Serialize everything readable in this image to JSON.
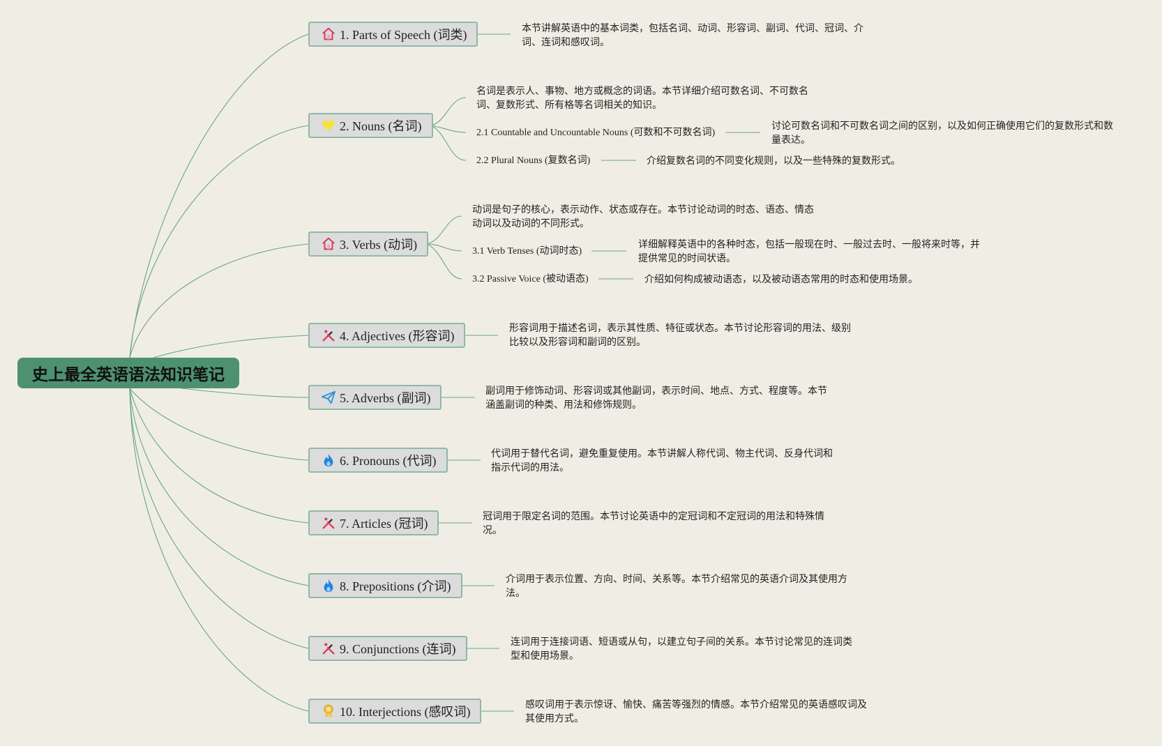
{
  "root": {
    "title": "史上最全英语语法知识笔记"
  },
  "topics": [
    {
      "label": "1. Parts of Speech (词类)",
      "icon": "home-icon",
      "desc": "本节讲解英语中的基本词类，包括名词、动词、形容词、副词、代词、冠词、介词、连词和感叹词。"
    },
    {
      "label": "2. Nouns (名词)",
      "icon": "heart-icon",
      "desc": "名词是表示人、事物、地方或概念的词语。本节详细介绍可数名词、不可数名词、复数形式、所有格等名词相关的知识。",
      "subs": [
        {
          "label": "2.1 Countable and Uncountable Nouns (可数和不可数名词)",
          "desc": "讨论可数名词和不可数名词之间的区别，以及如何正确使用它们的复数形式和数量表达。"
        },
        {
          "label": "2.2 Plural Nouns (复数名词)",
          "desc": "介绍复数名词的不同变化规则，以及一些特殊的复数形式。"
        }
      ]
    },
    {
      "label": "3. Verbs (动词)",
      "icon": "home-icon",
      "desc": "动词是句子的核心，表示动作、状态或存在。本节讨论动词的时态、语态、情态动词以及动词的不同形式。",
      "subs": [
        {
          "label": "3.1 Verb Tenses (动词时态)",
          "desc": "详细解释英语中的各种时态，包括一般现在时、一般过去时、一般将来时等，并提供常见的时间状语。"
        },
        {
          "label": "3.2 Passive Voice (被动语态)",
          "desc": "介绍如何构成被动语态，以及被动语态常用的时态和使用场景。"
        }
      ]
    },
    {
      "label": "4. Adjectives (形容词)",
      "icon": "tools-icon",
      "desc": "形容词用于描述名词，表示其性质、特征或状态。本节讨论形容词的用法、级别比较以及形容词和副词的区别。"
    },
    {
      "label": "5. Adverbs (副词)",
      "icon": "paper-plane-icon",
      "desc": "副词用于修饰动词、形容词或其他副词，表示时间、地点、方式、程度等。本节涵盖副词的种类、用法和修饰规则。"
    },
    {
      "label": "6. Pronouns (代词)",
      "icon": "flame-icon",
      "desc": "代词用于替代名词，避免重复使用。本节讲解人称代词、物主代词、反身代词和指示代词的用法。"
    },
    {
      "label": "7. Articles (冠词)",
      "icon": "tools-icon",
      "desc": "冠词用于限定名词的范围。本节讨论英语中的定冠词和不定冠词的用法和特殊情况。"
    },
    {
      "label": "8. Prepositions (介词)",
      "icon": "flame-icon",
      "desc": "介词用于表示位置、方向、时间、关系等。本节介绍常见的英语介词及其使用方法。"
    },
    {
      "label": "9. Conjunctions (连词)",
      "icon": "tools-icon",
      "desc": "连词用于连接词语、短语或从句，以建立句子间的关系。本节讨论常见的连词类型和使用场景。"
    },
    {
      "label": "10. Interjections (感叹词)",
      "icon": "award-icon",
      "desc": "感叹词用于表示惊讶、愉快、痛苦等强烈的情感。本节介绍常见的英语感叹词及其使用方式。"
    }
  ],
  "colors": {
    "background": "#f0eee4",
    "root": "#4e9170",
    "node_fill": "#dcdcdc",
    "node_border": "#8fb8a7",
    "connector": "#6aa38d"
  }
}
